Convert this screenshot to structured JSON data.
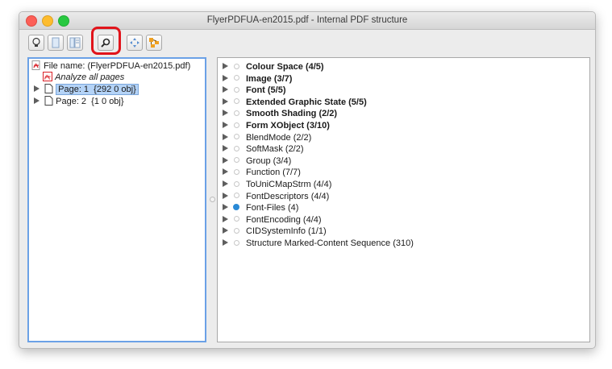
{
  "window": {
    "title": "FlyerPDFUA-en2015.pdf - Internal PDF structure"
  },
  "toolbar": {
    "buttons": [
      {
        "icon": "lightbulb-icon"
      },
      {
        "icon": "document-icon"
      },
      {
        "icon": "page-layout-icon"
      },
      {
        "icon": "search-icon",
        "highlighted": true
      },
      {
        "icon": "navigation-arrows-icon"
      },
      {
        "icon": "structure-tree-icon"
      }
    ],
    "highlight_color": "#e1141b"
  },
  "left_tree": {
    "file_name": "File name: (FlyerPDFUA-en2015.pdf)",
    "analyze": "Analyze all pages",
    "pages": [
      {
        "label": "Page: 1",
        "obj": "{292 0 obj}",
        "selected": true
      },
      {
        "label": "Page: 2",
        "obj": "{1 0 obj}",
        "selected": false
      }
    ]
  },
  "right_tree": {
    "items": [
      {
        "label": "Colour Space (4/5)",
        "bold": true
      },
      {
        "label": "Image (3/7)",
        "bold": true
      },
      {
        "label": "Font (5/5)",
        "bold": true
      },
      {
        "label": "Extended Graphic State (5/5)",
        "bold": true
      },
      {
        "label": "Smooth Shading (2/2)",
        "bold": true
      },
      {
        "label": "Form XObject (3/10)",
        "bold": true
      },
      {
        "label": "BlendMode (2/2)",
        "bold": false
      },
      {
        "label": "SoftMask (2/2)",
        "bold": false
      },
      {
        "label": "Group (3/4)",
        "bold": false
      },
      {
        "label": "Function (7/7)",
        "bold": false
      },
      {
        "label": "ToUniCMapStrm (4/4)",
        "bold": false
      },
      {
        "label": "FontDescriptors (4/4)",
        "bold": false
      },
      {
        "label": "Font-Files (4)",
        "bold": false,
        "info_icon": true
      },
      {
        "label": "FontEncoding (4/4)",
        "bold": false
      },
      {
        "label": "CIDSystemInfo (1/1)",
        "bold": false
      },
      {
        "label": "Structure Marked-Content Sequence (310)",
        "bold": false
      }
    ]
  },
  "colors": {
    "selection": "#b4d3f7",
    "left_pane_focus": "#6ba1e6",
    "pdf_red": "#d9232a",
    "info_blue": "#2a8ad6"
  }
}
